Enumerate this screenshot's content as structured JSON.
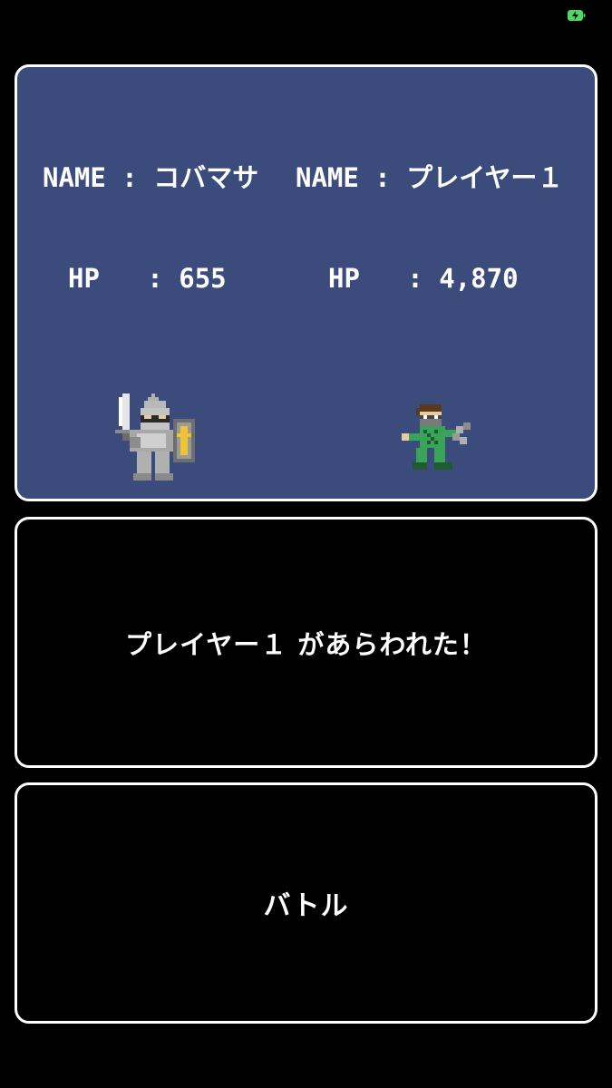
{
  "status_bar": {
    "battery_icon": "battery-charging-icon",
    "battery_color": "#4cd964"
  },
  "battle": {
    "background_color": "#3b4c7c",
    "player": {
      "name_key": "NAME",
      "name_sep": " : ",
      "name": "コバマサ",
      "hp_key": "HP",
      "hp_sep": "   : ",
      "hp": "655",
      "sprite": "knight-sprite"
    },
    "enemy": {
      "name_key": "NAME",
      "name_sep": " : ",
      "name": "プレイヤー１",
      "hp_key": "HP",
      "hp_sep": "   : ",
      "hp": "4,870",
      "sprite": "ninja-sprite"
    }
  },
  "message": {
    "text": "プレイヤー１ があらわれた！"
  },
  "command": {
    "label": "バトル"
  }
}
